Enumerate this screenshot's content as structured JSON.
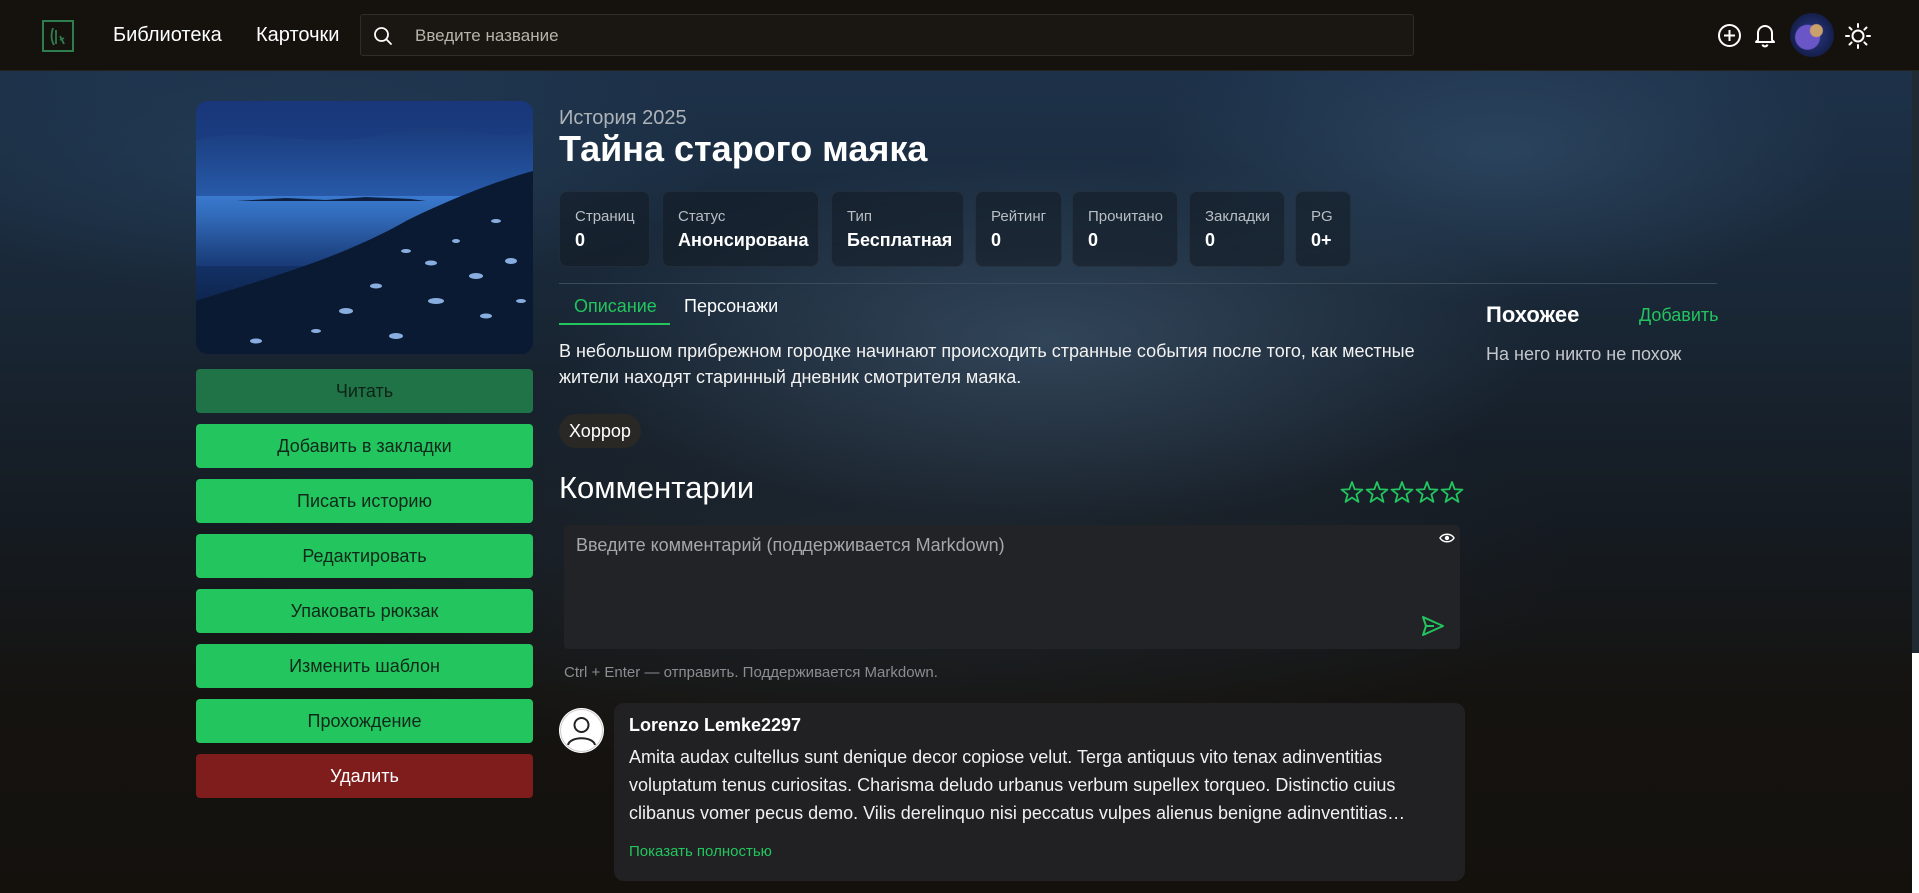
{
  "header": {
    "nav": [
      "Библиотека",
      "Карточки"
    ],
    "search_placeholder": "Введите название"
  },
  "story": {
    "subtitle": "История 2025",
    "title": "Тайна старого маяка",
    "stats": [
      {
        "label": "Страниц",
        "value": "0"
      },
      {
        "label": "Статус",
        "value": "Анонсирована"
      },
      {
        "label": "Тип",
        "value": "Бесплатная"
      },
      {
        "label": "Рейтинг",
        "value": "0"
      },
      {
        "label": "Прочитано",
        "value": "0"
      },
      {
        "label": "Закладки",
        "value": "0"
      },
      {
        "label": "PG",
        "value": "0+"
      }
    ],
    "tabs": [
      "Описание",
      "Персонажи"
    ],
    "description": "В небольшом прибрежном городке начинают происходить странные события после того, как местные жители находят старинный дневник смотрителя маяка.",
    "tags": [
      "Хоррор"
    ]
  },
  "actions": {
    "read": "Читать",
    "bookmark": "Добавить в закладки",
    "write": "Писать историю",
    "edit": "Редактировать",
    "pack": "Упаковать рюкзак",
    "template": "Изменить шаблон",
    "walkthrough": "Прохождение",
    "delete": "Удалить"
  },
  "comments": {
    "heading": "Комментарии",
    "rating_stars": 5,
    "rating_value": 0,
    "placeholder": "Введите комментарий (поддерживается Markdown)",
    "hint": "Ctrl + Enter — отправить. Поддерживается Markdown.",
    "items": [
      {
        "author": "Lorenzo Lemke2297",
        "text": "Amita audax cultellus sunt denique decor copiose velut. Terga antiquus vito tenax adinventitias voluptatum tenus curiositas. Charisma deludo urbanus verbum supellex torqueo. Distinctio cuius clibanus vomer pecus demo. Vilis derelinquo nisi peccatus vulpes alienus benigne adinventitias cohibeo. Adipisci…",
        "show_more": "Показать полностью"
      }
    ]
  },
  "similar": {
    "heading": "Похожее",
    "add": "Добавить",
    "empty": "На него никто не похож"
  },
  "colors": {
    "accent": "#22c55e",
    "danger": "#7f1d1d",
    "header_bg": "#15120e"
  }
}
